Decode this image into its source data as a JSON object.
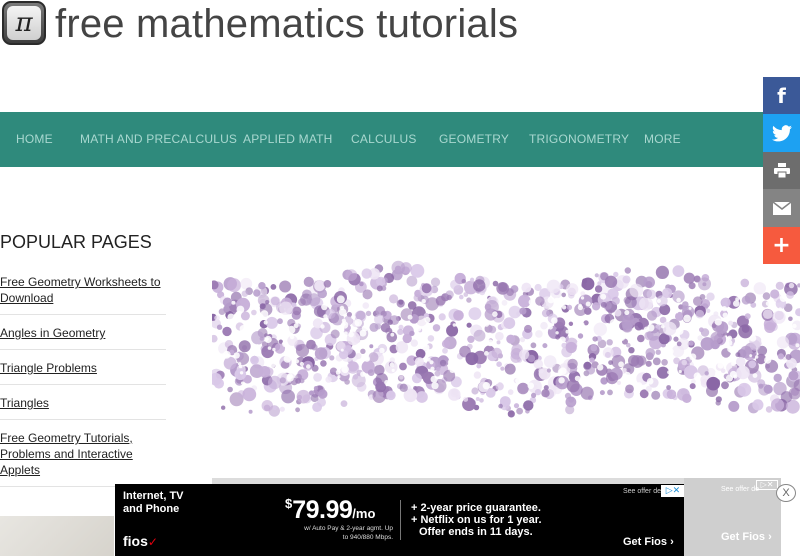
{
  "header": {
    "logo_glyph": "π",
    "site_title": "free mathematics tutorials"
  },
  "nav": {
    "items": [
      {
        "label": "HOME"
      },
      {
        "label": "MATH AND PRECALCULUS"
      },
      {
        "label": "APPLIED MATH"
      },
      {
        "label": "CALCULUS"
      },
      {
        "label": "GEOMETRY"
      },
      {
        "label": "TRIGONOMETRY"
      },
      {
        "label": "MORE"
      }
    ]
  },
  "sidebar": {
    "heading": "POPULAR PAGES",
    "items": [
      {
        "label": "Free Geometry Worksheets to Download"
      },
      {
        "label": "Angles in Geometry"
      },
      {
        "label": "Triangle Problems"
      },
      {
        "label": "Triangles"
      },
      {
        "label": "Free Geometry Tutorials, Problems and Interactive Applets"
      }
    ]
  },
  "share": {
    "facebook_glyph": "f",
    "plus_glyph": "+",
    "colors": {
      "facebook": "#3b5998",
      "twitter": "#1da1f2",
      "print": "#6d6d6d",
      "email": "#848484",
      "more": "#f65a3e"
    }
  },
  "ad": {
    "headline": "Internet, TV and Phone",
    "brand": "fios",
    "price_dollar": "$",
    "price_main": "79.99",
    "price_suffix": "/mo",
    "price_note": "w/ Auto Pay & 2-year agmt. Up to 940/880 Mbps.",
    "offer_line1": "+ 2-year price guarantee.",
    "offer_line2": "+ Netflix on us for 1 year.",
    "offer_line3": "Offer ends in 11 days.",
    "see_offer": "See offer de",
    "cta": "Get Fios",
    "ghost_see_offer": "See offer de",
    "ghost_cta": "Get Fios",
    "close_glyph": "X"
  },
  "colors": {
    "nav_bg": "#2f8a7c",
    "nav_text": "#a9d8d0",
    "hero_flowers": "#9b7ab3"
  }
}
